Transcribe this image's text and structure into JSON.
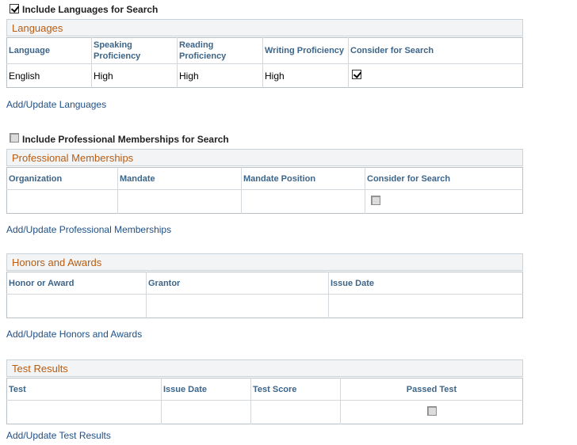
{
  "languages": {
    "include_label": "Include Languages for Search",
    "include_checked": true,
    "title": "Languages",
    "columns": [
      "Language",
      "Speaking Proficiency",
      "Reading Proficiency",
      "Writing Proficiency",
      "Consider for Search"
    ],
    "rows": [
      {
        "language": "English",
        "speaking": "High",
        "reading": "High",
        "writing": "High",
        "consider": true
      }
    ],
    "link": "Add/Update Languages"
  },
  "memberships": {
    "include_label": "Include Professional Memberships for Search",
    "include_checked": false,
    "title": "Professional Memberships",
    "columns": [
      "Organization",
      "Mandate",
      "Mandate Position",
      "Consider for Search"
    ],
    "link": "Add/Update Professional Memberships"
  },
  "honors": {
    "title": "Honors and Awards",
    "columns": [
      "Honor or Award",
      "Grantor",
      "Issue Date"
    ],
    "link": "Add/Update Honors and Awards"
  },
  "tests": {
    "title": "Test Results",
    "columns": [
      "Test",
      "Issue Date",
      "Test Score",
      "Passed Test"
    ],
    "link": "Add/Update Test Results"
  }
}
